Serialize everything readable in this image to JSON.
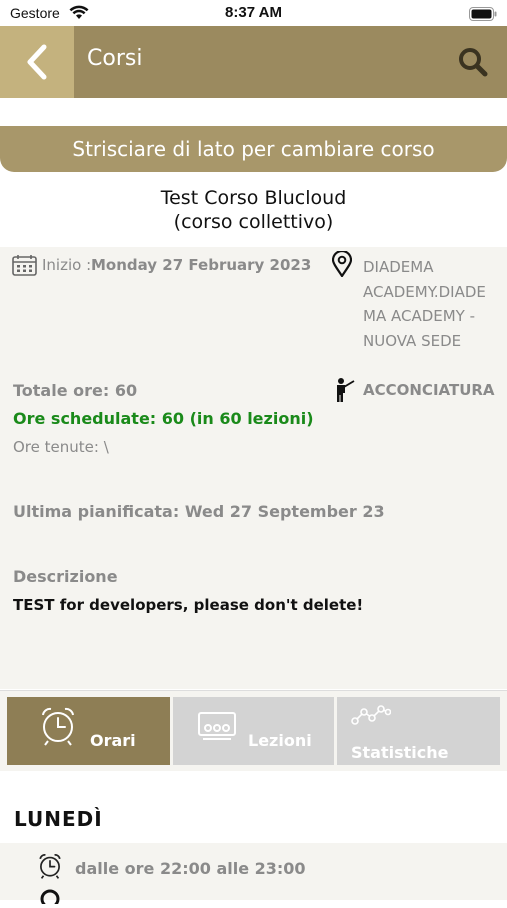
{
  "status_bar": {
    "carrier": "Gestore",
    "time": "8:37 AM"
  },
  "nav": {
    "title": "Corsi"
  },
  "banner": {
    "text": "Strisciare di lato per cambiare corso"
  },
  "course": {
    "name": "Test Corso Blucloud",
    "type": "(corso collettivo)"
  },
  "info": {
    "start_label": "Inizio :",
    "start_value": "Monday 27 February 2023",
    "location_lines": [
      "DIADEMA",
      "ACADEMY.DIADE",
      "MA ACADEMY -",
      "NUOVA SEDE"
    ],
    "total_hours": "Totale ore: 60",
    "scheduled_hours": "Ore schedulate: 60 (in 60 lezioni)",
    "hours_held": "Ore tenute: \\",
    "category": "ACCONCIATURA",
    "last_planned": "Ultima pianificata: Wed 27 September 23",
    "description_label": "Descrizione",
    "description_text": "TEST for developers, please don't delete!"
  },
  "tabs": [
    {
      "label": "Orari",
      "active": true,
      "icon": "alarm-clock-icon"
    },
    {
      "label": "Lezioni",
      "active": false,
      "icon": "classroom-icon"
    },
    {
      "label": "Statistiche",
      "active": false,
      "icon": "line-chart-icon"
    }
  ],
  "schedule": {
    "day": "LUNEDÌ",
    "slot": "dalle ore 22:00 alle 23:00"
  },
  "colors": {
    "accent": "#9b8a5f",
    "accent_light": "#c4b27e",
    "green": "#1a8a1a",
    "panel": "#f5f4f0"
  }
}
